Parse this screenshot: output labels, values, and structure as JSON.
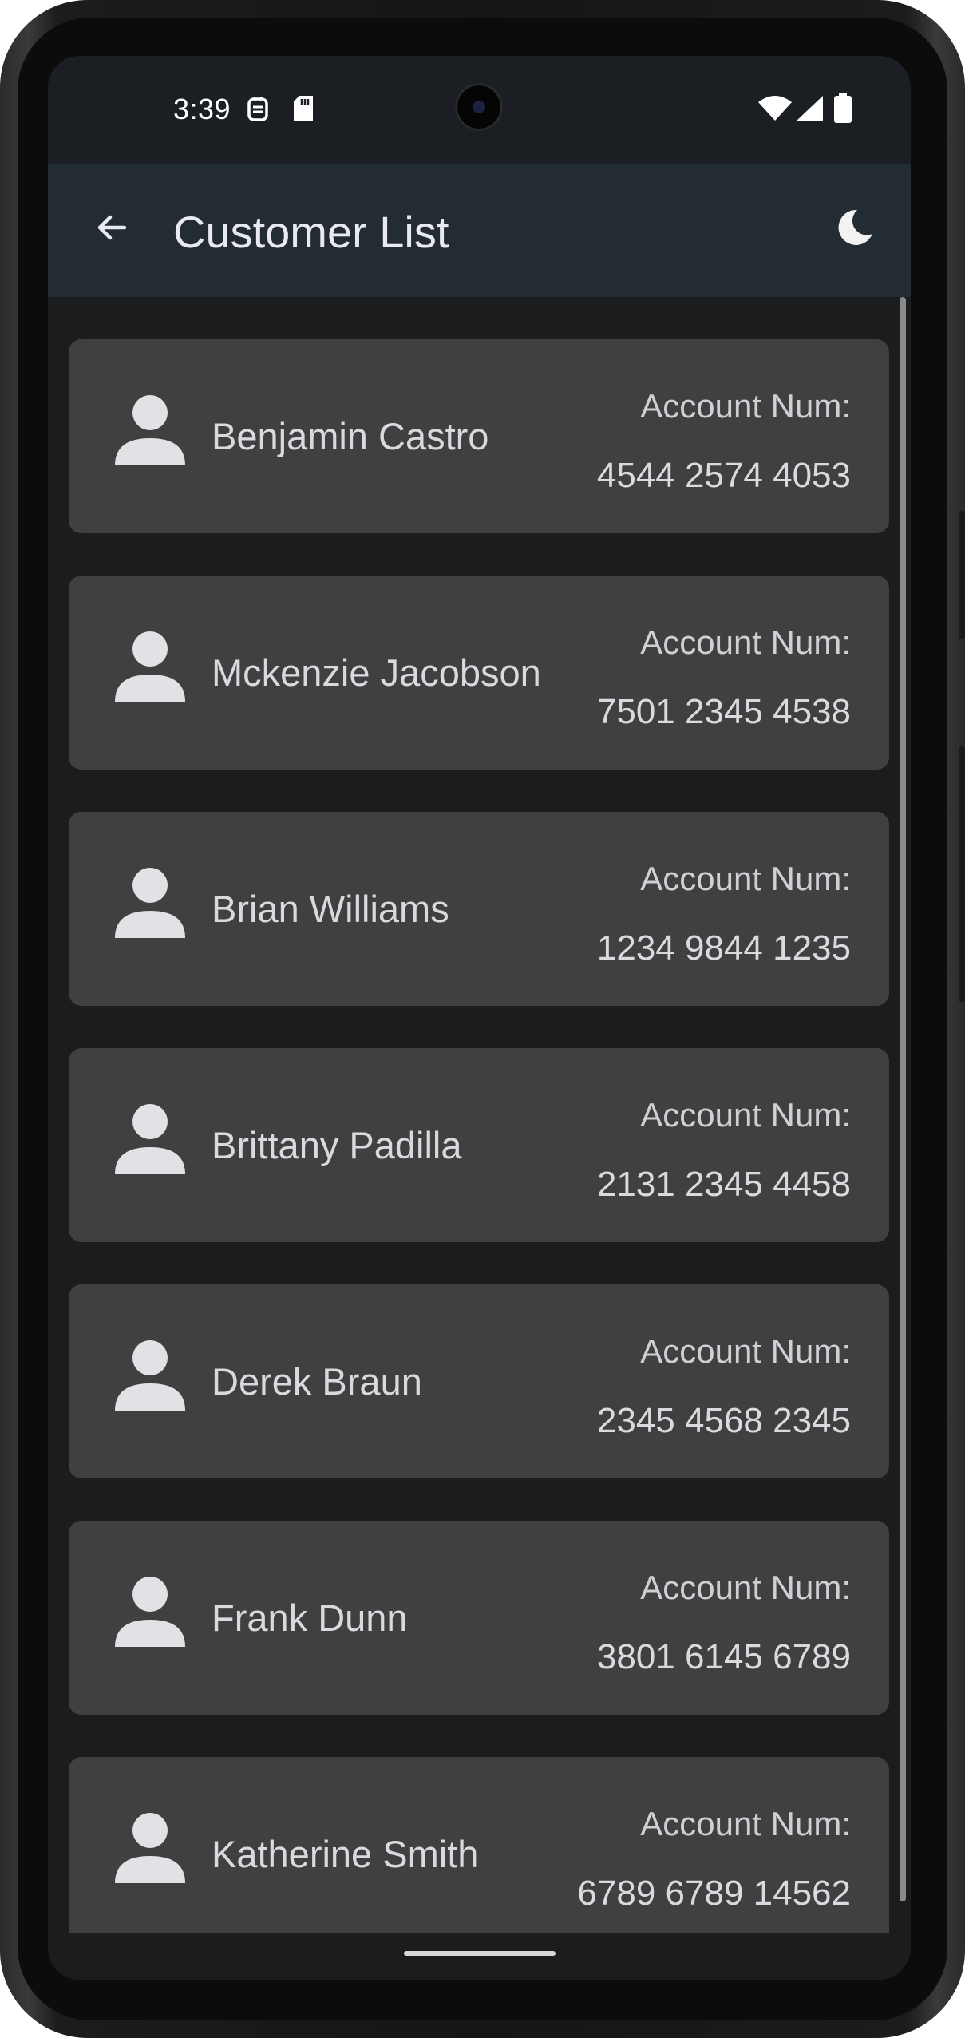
{
  "status_bar": {
    "time": "3:39",
    "icons": [
      "notification-app-icon",
      "sd-card-icon",
      "wifi-icon",
      "signal-icon",
      "battery-icon"
    ]
  },
  "app_bar": {
    "title": "Customer List",
    "back_icon": "arrow-back-icon",
    "theme_icon": "dark-mode-moon-icon"
  },
  "customers": [
    {
      "name": "Benjamin Castro",
      "account_label": "Account Num:",
      "account_number": "4544 2574 4053"
    },
    {
      "name": "Mckenzie Jacobson",
      "account_label": "Account Num:",
      "account_number": "7501 2345 4538"
    },
    {
      "name": "Brian Williams",
      "account_label": "Account Num:",
      "account_number": "1234 9844 1235"
    },
    {
      "name": "Brittany Padilla",
      "account_label": "Account Num:",
      "account_number": "2131 2345 4458"
    },
    {
      "name": "Derek Braun",
      "account_label": "Account Num:",
      "account_number": "2345 4568 2345"
    },
    {
      "name": "Frank Dunn",
      "account_label": "Account Num:",
      "account_number": "3801 6145 6789"
    },
    {
      "name": "Katherine Smith",
      "account_label": "Account Num:",
      "account_number": "6789 6789 14562"
    }
  ],
  "colors": {
    "app_bar": "#232b33",
    "background": "#1a1c1e",
    "card": "#404040",
    "text": "#d9d9df"
  }
}
